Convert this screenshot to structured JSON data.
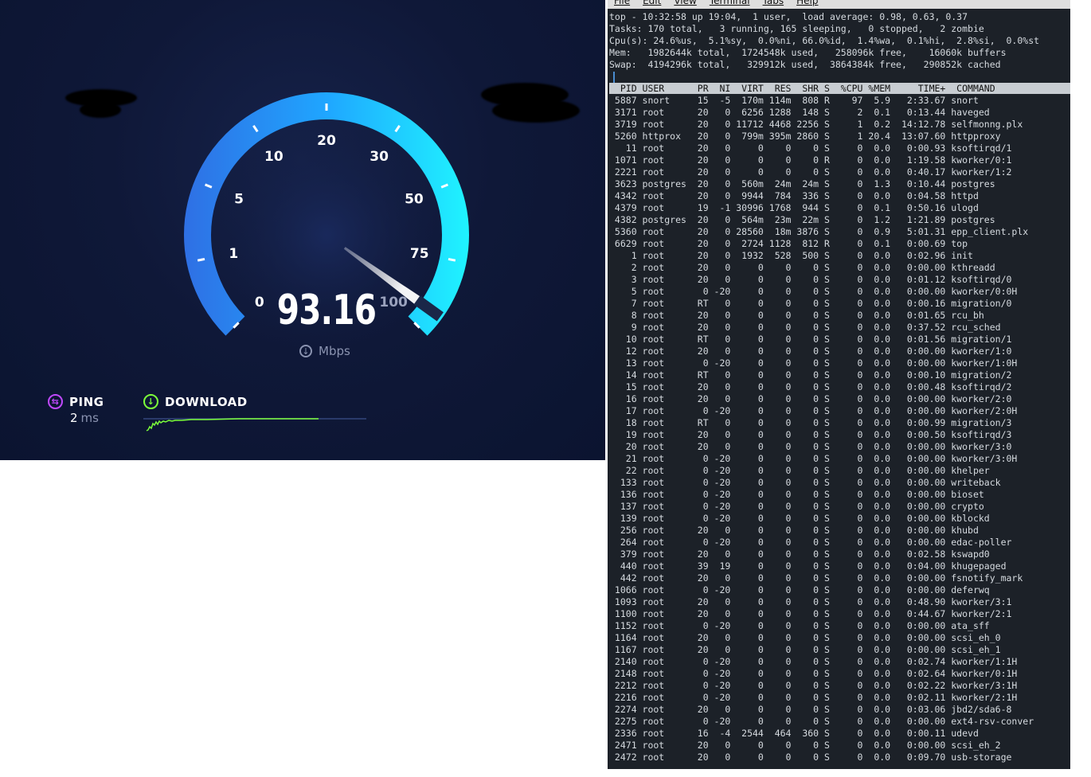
{
  "speedtest": {
    "ticks": [
      "0",
      "1",
      "5",
      "10",
      "20",
      "30",
      "50",
      "75",
      "100"
    ],
    "value": "93.16",
    "unit": "Mbps",
    "needle_speed": 93.16,
    "ping": {
      "label": "PING",
      "value": "2",
      "unit": "ms"
    },
    "download": {
      "label": "DOWNLOAD"
    },
    "colors": {
      "arc_start": "#2f6fe4",
      "arc_mid": "#1fa6ff",
      "arc_end": "#1ff4ff",
      "ping": "#c049ff",
      "download": "#7cff3a"
    }
  },
  "terminal": {
    "menu": [
      "File",
      "Edit",
      "View",
      "Terminal",
      "Tabs",
      "Help"
    ],
    "summary": [
      "top - 10:32:58 up 19:04,  1 user,  load average: 0.98, 0.63, 0.37",
      "Tasks: 170 total,   3 running, 165 sleeping,   0 stopped,   2 zombie",
      "Cpu(s): 24.6%us,  5.1%sy,  0.0%ni, 66.0%id,  1.4%wa,  0.1%hi,  2.8%si,  0.0%st",
      "Mem:   1982644k total,  1724548k used,   258096k free,    16060k buffers",
      "Swap:  4194296k total,   329912k used,  3864384k free,   290852k cached"
    ],
    "header": "  PID USER      PR  NI  VIRT  RES  SHR S  %CPU %MEM     TIME+  COMMAND",
    "rows": [
      " 5887 snort     15  -5  170m 114m  808 R    97  5.9   2:33.67 snort",
      " 3171 root      20   0  6256 1288  148 S     2  0.1   0:13.44 haveged",
      " 3719 root      20   0 11712 4468 2256 S     1  0.2  14:12.78 selfmonng.plx",
      " 5260 httprox   20   0  799m 395m 2860 S     1 20.4  13:07.60 httpproxy",
      "   11 root      20   0     0    0    0 S     0  0.0   0:00.93 ksoftirqd/1",
      " 1071 root      20   0     0    0    0 R     0  0.0   1:19.58 kworker/0:1",
      " 2221 root      20   0     0    0    0 S     0  0.0   0:40.17 kworker/1:2",
      " 3623 postgres  20   0  560m  24m  24m S     0  1.3   0:10.44 postgres",
      " 4342 root      20   0  9944  784  336 S     0  0.0   0:04.58 httpd",
      " 4379 root      19  -1 30996 1768  944 S     0  0.1   0:50.16 ulogd",
      " 4382 postgres  20   0  564m  23m  22m S     0  1.2   1:21.89 postgres",
      " 5360 root      20   0 28560  18m 3876 S     0  0.9   5:01.31 epp_client.plx",
      " 6629 root      20   0  2724 1128  812 R     0  0.1   0:00.69 top",
      "    1 root      20   0  1932  528  500 S     0  0.0   0:02.96 init",
      "    2 root      20   0     0    0    0 S     0  0.0   0:00.00 kthreadd",
      "    3 root      20   0     0    0    0 S     0  0.0   0:01.12 ksoftirqd/0",
      "    5 root       0 -20     0    0    0 S     0  0.0   0:00.00 kworker/0:0H",
      "    7 root      RT   0     0    0    0 S     0  0.0   0:00.16 migration/0",
      "    8 root      20   0     0    0    0 S     0  0.0   0:01.65 rcu_bh",
      "    9 root      20   0     0    0    0 S     0  0.0   0:37.52 rcu_sched",
      "   10 root      RT   0     0    0    0 S     0  0.0   0:01.56 migration/1",
      "   12 root      20   0     0    0    0 S     0  0.0   0:00.00 kworker/1:0",
      "   13 root       0 -20     0    0    0 S     0  0.0   0:00.00 kworker/1:0H",
      "   14 root      RT   0     0    0    0 S     0  0.0   0:00.10 migration/2",
      "   15 root      20   0     0    0    0 S     0  0.0   0:00.48 ksoftirqd/2",
      "   16 root      20   0     0    0    0 S     0  0.0   0:00.00 kworker/2:0",
      "   17 root       0 -20     0    0    0 S     0  0.0   0:00.00 kworker/2:0H",
      "   18 root      RT   0     0    0    0 S     0  0.0   0:00.99 migration/3",
      "   19 root      20   0     0    0    0 S     0  0.0   0:00.50 ksoftirqd/3",
      "   20 root      20   0     0    0    0 S     0  0.0   0:00.00 kworker/3:0",
      "   21 root       0 -20     0    0    0 S     0  0.0   0:00.00 kworker/3:0H",
      "   22 root       0 -20     0    0    0 S     0  0.0   0:00.00 khelper",
      "  133 root       0 -20     0    0    0 S     0  0.0   0:00.00 writeback",
      "  136 root       0 -20     0    0    0 S     0  0.0   0:00.00 bioset",
      "  137 root       0 -20     0    0    0 S     0  0.0   0:00.00 crypto",
      "  139 root       0 -20     0    0    0 S     0  0.0   0:00.00 kblockd",
      "  256 root      20   0     0    0    0 S     0  0.0   0:00.00 khubd",
      "  264 root       0 -20     0    0    0 S     0  0.0   0:00.00 edac-poller",
      "  379 root      20   0     0    0    0 S     0  0.0   0:02.58 kswapd0",
      "  440 root      39  19     0    0    0 S     0  0.0   0:04.00 khugepaged",
      "  442 root      20   0     0    0    0 S     0  0.0   0:00.00 fsnotify_mark",
      " 1066 root       0 -20     0    0    0 S     0  0.0   0:00.00 deferwq",
      " 1093 root      20   0     0    0    0 S     0  0.0   0:48.90 kworker/3:1",
      " 1100 root      20   0     0    0    0 S     0  0.0   0:44.67 kworker/2:1",
      " 1152 root       0 -20     0    0    0 S     0  0.0   0:00.00 ata_sff",
      " 1164 root      20   0     0    0    0 S     0  0.0   0:00.00 scsi_eh_0",
      " 1167 root      20   0     0    0    0 S     0  0.0   0:00.00 scsi_eh_1",
      " 2140 root       0 -20     0    0    0 S     0  0.0   0:02.74 kworker/1:1H",
      " 2148 root       0 -20     0    0    0 S     0  0.0   0:02.64 kworker/0:1H",
      " 2212 root       0 -20     0    0    0 S     0  0.0   0:02.22 kworker/3:1H",
      " 2216 root       0 -20     0    0    0 S     0  0.0   0:02.11 kworker/2:1H",
      " 2274 root      20   0     0    0    0 S     0  0.0   0:03.06 jbd2/sda6-8",
      " 2275 root       0 -20     0    0    0 S     0  0.0   0:00.00 ext4-rsv-conver",
      " 2336 root      16  -4  2544  464  360 S     0  0.0   0:00.11 udevd",
      " 2471 root      20   0     0    0    0 S     0  0.0   0:00.00 scsi_eh_2",
      " 2472 root      20   0     0    0    0 S     0  0.0   0:09.70 usb-storage"
    ]
  }
}
